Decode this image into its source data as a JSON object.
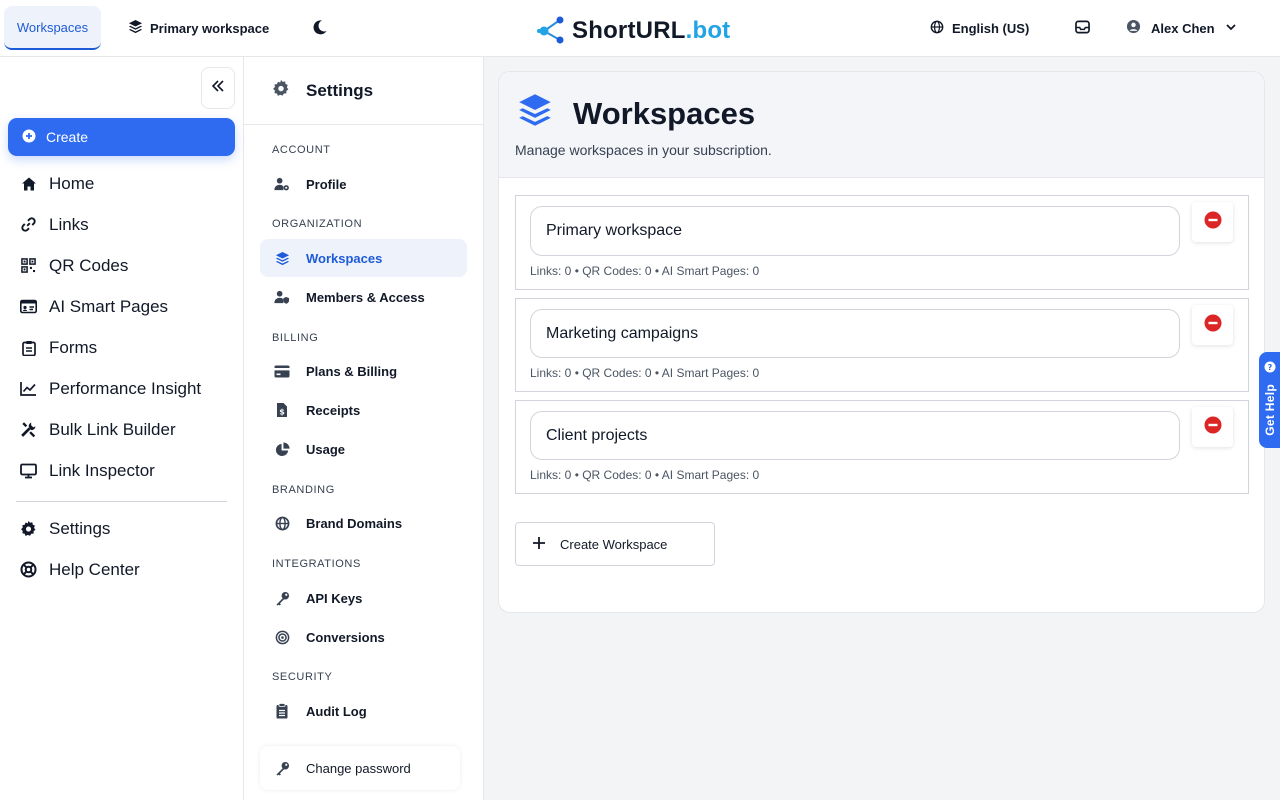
{
  "topbar": {
    "tab_label": "Workspaces",
    "workspace_switcher": "Primary workspace",
    "logo": {
      "part1": "ShortURL",
      "part2": ".bot"
    },
    "language": "English (US)",
    "user_name": "Alex Chen"
  },
  "leftnav": {
    "create_label": "Create",
    "items": [
      {
        "label": "Home",
        "icon": "home-icon"
      },
      {
        "label": "Links",
        "icon": "link-icon"
      },
      {
        "label": "QR Codes",
        "icon": "qr-code-icon"
      },
      {
        "label": "AI Smart Pages",
        "icon": "id-card-icon"
      },
      {
        "label": "Forms",
        "icon": "clipboard-icon"
      },
      {
        "label": "Performance Insight",
        "icon": "chart-line-icon"
      },
      {
        "label": "Bulk Link Builder",
        "icon": "tools-icon"
      },
      {
        "label": "Link Inspector",
        "icon": "monitor-icon"
      }
    ],
    "items_bottom": [
      {
        "label": "Settings",
        "icon": "gear-icon"
      },
      {
        "label": "Help Center",
        "icon": "life-ring-icon"
      }
    ]
  },
  "settings": {
    "title": "Settings",
    "sections": {
      "account": "ACCOUNT",
      "organization": "ORGANIZATION",
      "billing": "BILLING",
      "branding": "BRANDING",
      "integrations": "INTEGRATIONS",
      "security": "SECURITY"
    },
    "items": {
      "profile": "Profile",
      "workspaces": "Workspaces",
      "members": "Members & Access",
      "plans": "Plans & Billing",
      "receipts": "Receipts",
      "usage": "Usage",
      "brand_domains": "Brand Domains",
      "api_keys": "API Keys",
      "conversions": "Conversions",
      "audit_log": "Audit Log",
      "change_password": "Change password"
    }
  },
  "main": {
    "title": "Workspaces",
    "subtitle": "Manage workspaces in your subscription.",
    "workspaces": [
      {
        "name": "Primary workspace",
        "meta": "Links: 0 • QR Codes: 0 • AI Smart Pages: 0"
      },
      {
        "name": "Marketing campaigns",
        "meta": "Links: 0 • QR Codes: 0 • AI Smart Pages: 0"
      },
      {
        "name": "Client projects",
        "meta": "Links: 0 • QR Codes: 0 • AI Smart Pages: 0"
      }
    ],
    "create_label": "Create Workspace"
  },
  "help_tab": "Get Help",
  "colors": {
    "accent": "#2f6bf0",
    "logo_accent": "#21a3e6",
    "delete": "#dc2626"
  }
}
